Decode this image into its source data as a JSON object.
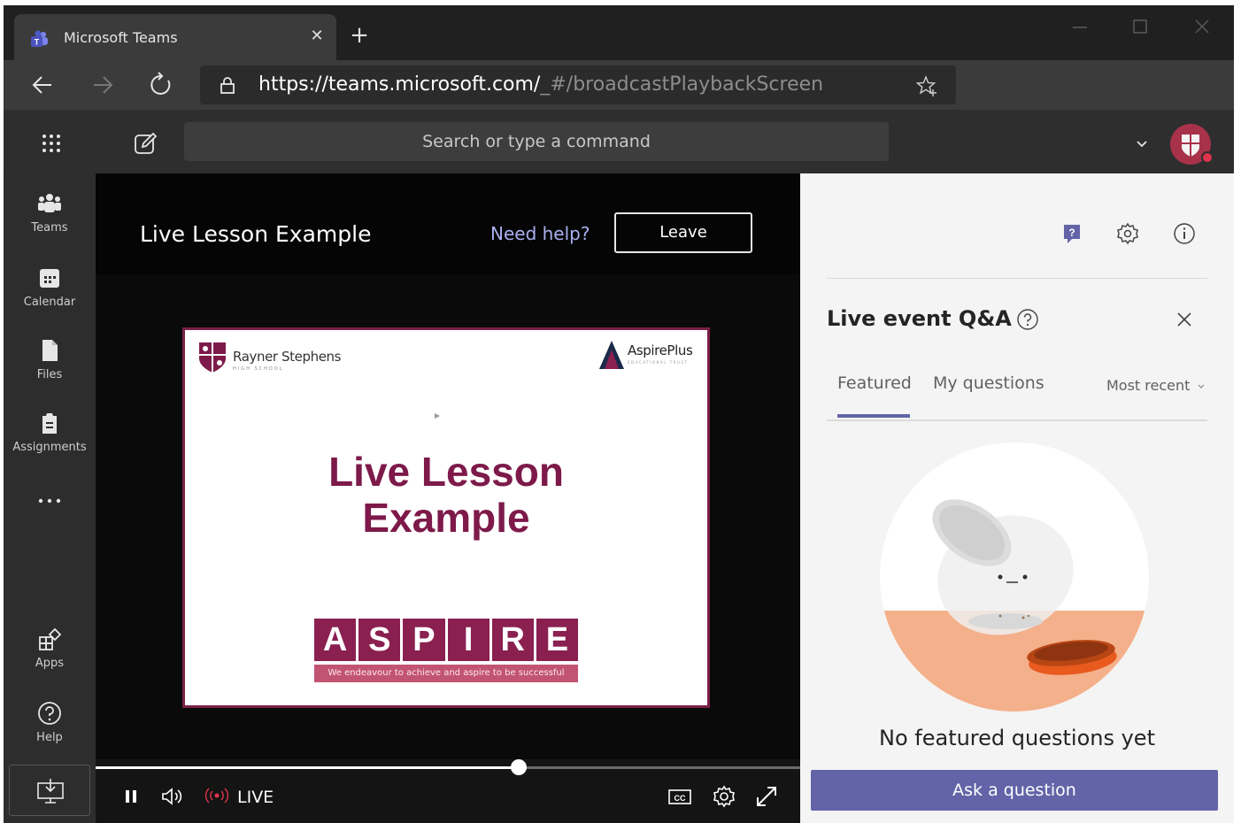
{
  "browser": {
    "tab_title": "Microsoft Teams",
    "url_host": "https://teams.microsoft.com/",
    "url_path": "_#/broadcastPlaybackScreen"
  },
  "teams": {
    "search_placeholder": "Search or type a command"
  },
  "rail": {
    "items": [
      {
        "label": "Teams",
        "icon": "teams-icon"
      },
      {
        "label": "Calendar",
        "icon": "calendar-icon"
      },
      {
        "label": "Files",
        "icon": "files-icon"
      },
      {
        "label": "Assignments",
        "icon": "assignments-icon"
      }
    ],
    "bottom_items": [
      {
        "label": "Apps",
        "icon": "apps-icon"
      },
      {
        "label": "Help",
        "icon": "help-icon"
      }
    ]
  },
  "stage": {
    "event_title": "Live Lesson Example",
    "need_help": "Need help?",
    "leave": "Leave",
    "live_label": "LIVE",
    "playback_progress": 0.6
  },
  "slide": {
    "school_name": "Rayner Stephens",
    "school_sub": "HIGH SCHOOL",
    "partner_name": "AspirePlus",
    "partner_sub": "EDUCATIONAL TRUST",
    "title_line1": "Live Lesson",
    "title_line2": "Example",
    "logo_letters": [
      "A",
      "S",
      "P",
      "I",
      "R",
      "E"
    ],
    "logo_tagline": "We endeavour to achieve and aspire to be successful"
  },
  "qa": {
    "title": "Live event Q&A",
    "tab_featured": "Featured",
    "tab_mine": "My questions",
    "sort": "Most recent",
    "empty_text": "No featured questions yet",
    "ask_button": "Ask a question"
  },
  "colors": {
    "accent": "#6264a7",
    "slide_maroon": "#7d1a4a",
    "live_red": "#e0344c"
  }
}
